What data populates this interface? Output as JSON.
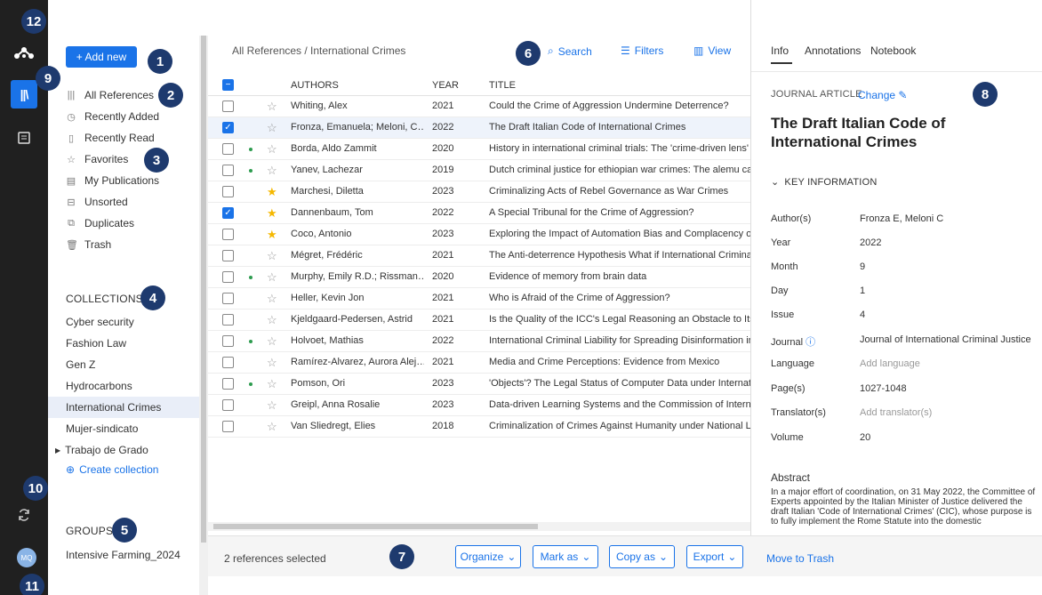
{
  "badges": [
    "1",
    "2",
    "3",
    "4",
    "5",
    "6",
    "7",
    "8",
    "9",
    "10",
    "11",
    "12"
  ],
  "rail": {
    "avatar_initials": "MQ"
  },
  "sidebar": {
    "add_new": "+ Add new",
    "nav": [
      {
        "label": "All References",
        "icon": "library-icon"
      },
      {
        "label": "Recently Added",
        "icon": "clock-icon"
      },
      {
        "label": "Recently Read",
        "icon": "bookmark-icon"
      },
      {
        "label": "Favorites",
        "icon": "star-icon"
      },
      {
        "label": "My Publications",
        "icon": "document-icon"
      },
      {
        "label": "Unsorted",
        "icon": "inbox-icon"
      },
      {
        "label": "Duplicates",
        "icon": "duplicate-icon"
      },
      {
        "label": "Trash",
        "icon": "trash-icon"
      }
    ],
    "collections_title": "COLLECTIONS",
    "collections": [
      "Cyber security",
      "Fashion Law",
      "Gen Z",
      "Hydrocarbons",
      "International Crimes",
      "Mujer-sindicato",
      "Trabajo de Grado"
    ],
    "create_collection": "Create collection",
    "groups_title": "GROUPS",
    "groups": [
      "Intensive Farming_2024"
    ]
  },
  "main": {
    "breadcrumb": "All References / International Crimes",
    "search": "Search",
    "filters": "Filters",
    "view": "View",
    "columns": {
      "authors": "AUTHORS",
      "year": "YEAR",
      "title": "TITLE"
    },
    "rows": [
      {
        "authors": "Whiting, Alex",
        "year": "2021",
        "title": "Could the Crime of Aggression Undermine Deterrence?",
        "checked": false,
        "star": false,
        "dot": false
      },
      {
        "authors": "Fronza, Emanuela; Meloni, C…",
        "year": "2022",
        "title": "The Draft Italian Code of International Crimes",
        "checked": true,
        "star": false,
        "dot": false
      },
      {
        "authors": "Borda, Aldo Zammit",
        "year": "2020",
        "title": "History in international criminal trials: The 'crime-driven lens' ar",
        "checked": false,
        "star": false,
        "dot": true
      },
      {
        "authors": "Yanev, Lachezar",
        "year": "2019",
        "title": "Dutch criminal justice for ethiopian war crimes: The alemu case",
        "checked": false,
        "star": false,
        "dot": true
      },
      {
        "authors": "Marchesi, Diletta",
        "year": "2023",
        "title": "Criminalizing Acts of Rebel Governance as War Crimes",
        "checked": false,
        "star": true,
        "dot": false
      },
      {
        "authors": "Dannenbaum, Tom",
        "year": "2022",
        "title": "A Special Tribunal for the Crime of Aggression?",
        "checked": true,
        "star": true,
        "dot": false
      },
      {
        "authors": "Coco, Antonio",
        "year": "2023",
        "title": "Exploring the Impact of Automation Bias and Complacency on",
        "checked": false,
        "star": true,
        "dot": false
      },
      {
        "authors": "Mégret, Frédéric",
        "year": "2021",
        "title": "The Anti-deterrence Hypothesis What if International Criminal J",
        "checked": false,
        "star": false,
        "dot": false
      },
      {
        "authors": "Murphy, Emily R.D.; Rissman…",
        "year": "2020",
        "title": "Evidence of memory from brain data",
        "checked": false,
        "star": false,
        "dot": true
      },
      {
        "authors": "Heller, Kevin Jon",
        "year": "2021",
        "title": "Who is Afraid of the Crime of Aggression?",
        "checked": false,
        "star": false,
        "dot": false
      },
      {
        "authors": "Kjeldgaard-Pedersen, Astrid",
        "year": "2021",
        "title": "Is the Quality of the ICC's Legal Reasoning an Obstacle to Its A",
        "checked": false,
        "star": false,
        "dot": false
      },
      {
        "authors": "Holvoet, Mathias",
        "year": "2022",
        "title": "International Criminal Liability for Spreading Disinformation in th",
        "checked": false,
        "star": false,
        "dot": true
      },
      {
        "authors": "Ramírez-Alvarez, Aurora Alej…",
        "year": "2021",
        "title": "Media and Crime Perceptions: Evidence from Mexico",
        "checked": false,
        "star": false,
        "dot": false
      },
      {
        "authors": "Pomson, Ori",
        "year": "2023",
        "title": "'Objects'? The Legal Status of Computer Data under Internation",
        "checked": false,
        "star": false,
        "dot": true
      },
      {
        "authors": "Greipl, Anna Rosalie",
        "year": "2023",
        "title": "Data-driven Learning Systems and the Commission of Internati",
        "checked": false,
        "star": false,
        "dot": false
      },
      {
        "authors": "Van Sliedregt, Elies",
        "year": "2018",
        "title": "Criminalization of Crimes Against Humanity under National Law",
        "checked": false,
        "star": false,
        "dot": false
      }
    ]
  },
  "bottom": {
    "selected": "2 references selected",
    "organize": "Organize",
    "mark_as": "Mark as",
    "copy_as": "Copy as",
    "export": "Export",
    "move_to_trash": "Move to Trash"
  },
  "panel": {
    "tabs": [
      "Info",
      "Annotations",
      "Notebook"
    ],
    "type": "JOURNAL ARTICLE",
    "change": "Change",
    "title": "The Draft Italian Code of International Crimes",
    "key_info": "KEY INFORMATION",
    "fields": [
      {
        "label": "Author(s)",
        "value": "Fronza E, Meloni C",
        "placeholder": false
      },
      {
        "label": "Year",
        "value": "2022",
        "placeholder": false
      },
      {
        "label": "Month",
        "value": "9",
        "placeholder": false
      },
      {
        "label": "Day",
        "value": "1",
        "placeholder": false
      },
      {
        "label": "Issue",
        "value": "4",
        "placeholder": false
      },
      {
        "label": "Journal",
        "value": "Journal of International Criminal Justice",
        "placeholder": false
      },
      {
        "label": "Language",
        "value": "Add language",
        "placeholder": true
      },
      {
        "label": "Page(s)",
        "value": "1027-1048",
        "placeholder": false
      },
      {
        "label": "Translator(s)",
        "value": "Add translator(s)",
        "placeholder": true
      },
      {
        "label": "Volume",
        "value": "20",
        "placeholder": false
      }
    ],
    "abstract_title": "Abstract",
    "abstract": "In a major effort of coordination, on 31 May 2022, the Committee of Experts appointed by the Italian Minister of Justice delivered the draft Italian 'Code of International Crimes' (CIC), whose purpose is to fully implement the Rome Statute into the domestic"
  },
  "colors": {
    "accent": "#1a73e8",
    "rail": "#202020",
    "badge": "#1e3a6e",
    "star": "#f5b800",
    "dot": "#2e9c4f"
  }
}
